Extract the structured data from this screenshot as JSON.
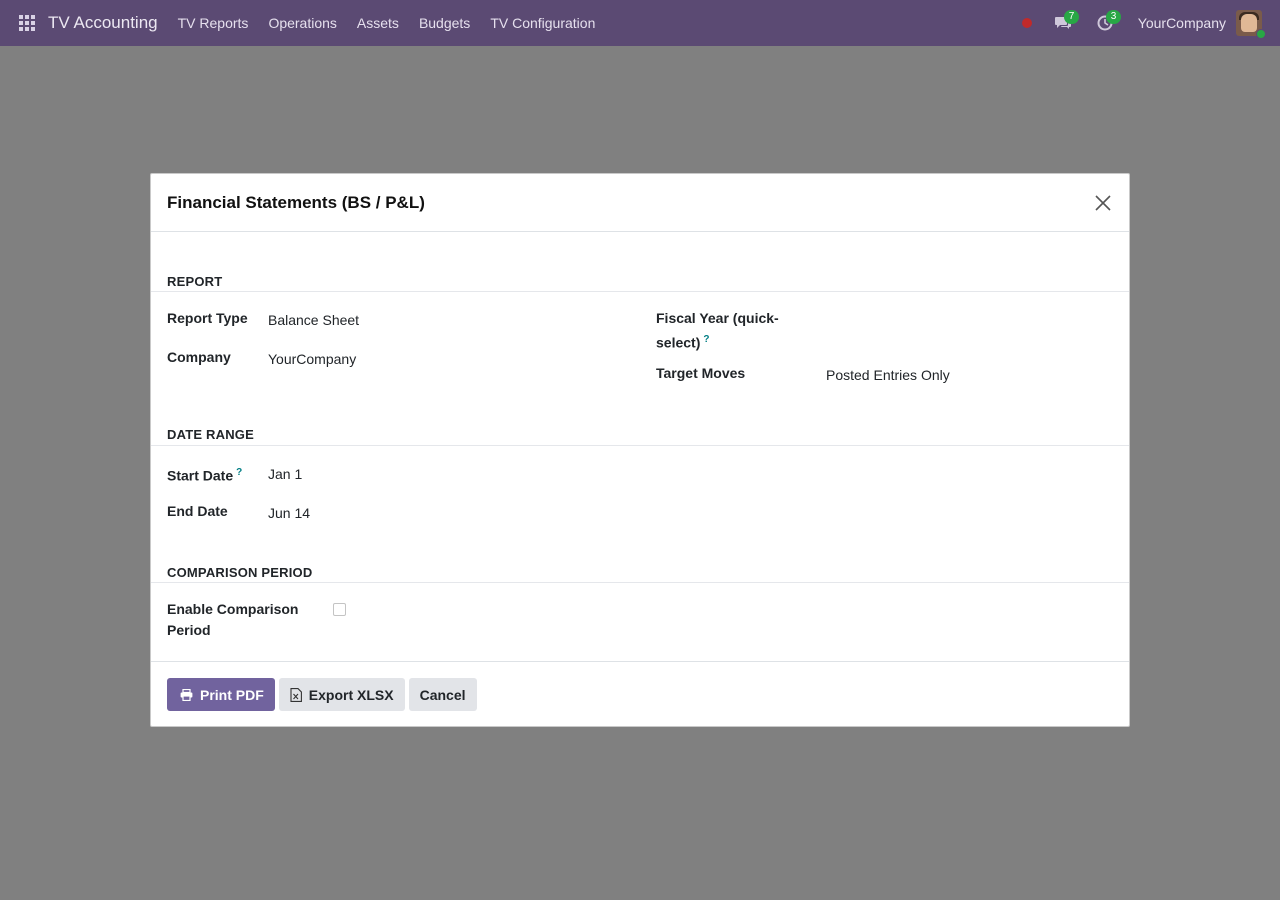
{
  "navbar": {
    "brand": "TV Accounting",
    "menu": [
      "TV Reports",
      "Operations",
      "Assets",
      "Budgets",
      "TV Configuration"
    ],
    "messages_count": "7",
    "activities_count": "3",
    "company": "YourCompany",
    "bg_color": "#5b4a73"
  },
  "modal": {
    "title": "Financial Statements (BS / P&L)",
    "sections": {
      "report": "REPORT",
      "date_range": "DATE RANGE",
      "comparison": "COMPARISON PERIOD"
    },
    "fields": {
      "report_type": {
        "label": "Report Type",
        "value": "Balance Sheet"
      },
      "company": {
        "label": "Company",
        "value": "YourCompany"
      },
      "fiscal_year": {
        "label_line1": "Fiscal Year (quick-",
        "label_line2": "select)",
        "help": "?",
        "value": ""
      },
      "target_moves": {
        "label": "Target Moves",
        "value": "Posted Entries Only"
      },
      "start_date": {
        "label": "Start Date",
        "help": "?",
        "value": "Jan 1"
      },
      "end_date": {
        "label": "End Date",
        "value": "Jun 14"
      },
      "enable_comparison": {
        "label_line1": "Enable Comparison",
        "label_line2": "Period",
        "checked": false
      }
    },
    "buttons": {
      "print_pdf": "Print PDF",
      "export_xlsx": "Export XLSX",
      "cancel": "Cancel"
    },
    "primary_color": "#71639e"
  }
}
